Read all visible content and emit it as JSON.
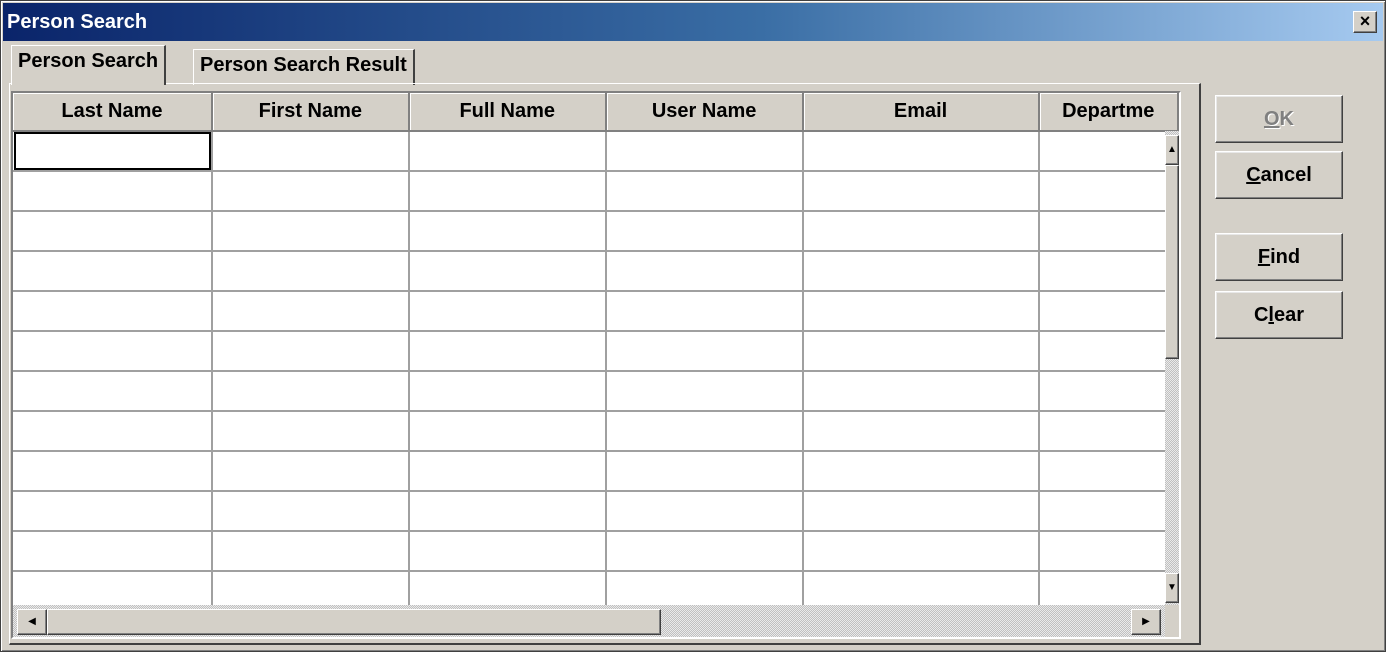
{
  "window": {
    "title": "Person Search",
    "close_glyph": "×",
    "titlebar_gradient": [
      "#0a246a",
      "#3a6ea5",
      "#a6caf0"
    ],
    "face_color": "#d4d0c8"
  },
  "tabs": [
    {
      "label": "Person Search",
      "active": true
    },
    {
      "label": "Person Search Result",
      "active": false
    }
  ],
  "grid": {
    "columns": [
      "Last Name",
      "First Name",
      "Full Name",
      "User Name",
      "Email",
      "Departme"
    ],
    "rows": [
      [
        "",
        "",
        "",
        "",
        "",
        ""
      ],
      [
        "",
        "",
        "",
        "",
        "",
        ""
      ],
      [
        "",
        "",
        "",
        "",
        "",
        ""
      ],
      [
        "",
        "",
        "",
        "",
        "",
        ""
      ],
      [
        "",
        "",
        "",
        "",
        "",
        ""
      ],
      [
        "",
        "",
        "",
        "",
        "",
        ""
      ],
      [
        "",
        "",
        "",
        "",
        "",
        ""
      ],
      [
        "",
        "",
        "",
        "",
        "",
        ""
      ],
      [
        "",
        "",
        "",
        "",
        "",
        ""
      ],
      [
        "",
        "",
        "",
        "",
        "",
        ""
      ],
      [
        "",
        "",
        "",
        "",
        "",
        ""
      ],
      [
        "",
        "",
        "",
        "",
        "",
        ""
      ]
    ],
    "focused_cell": {
      "row": 0,
      "col": 0
    },
    "scroll_icons": {
      "up": "▲",
      "down": "▼",
      "left": "◀",
      "right": "▶"
    }
  },
  "buttons": {
    "ok": {
      "mnemonic": "O",
      "rest": "K",
      "enabled": false
    },
    "cancel": {
      "mnemonic": "C",
      "rest": "ancel",
      "enabled": true
    },
    "find": {
      "mnemonic": "F",
      "rest": "ind",
      "enabled": true
    },
    "clear": {
      "prefix": "C",
      "mnemonic": "l",
      "rest": "ear",
      "enabled": true
    }
  }
}
